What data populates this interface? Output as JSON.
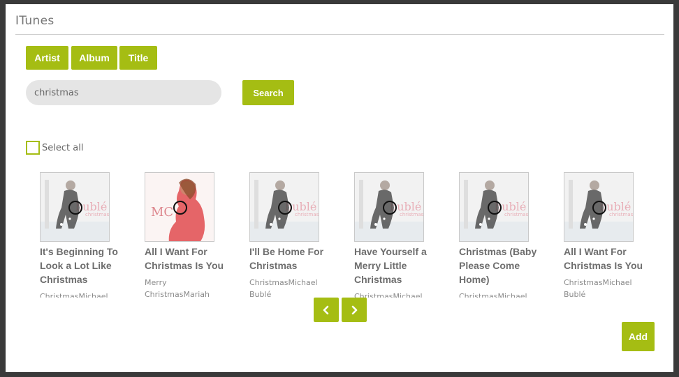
{
  "modal": {
    "title": "ITunes"
  },
  "filters": {
    "artist_label": "Artist",
    "album_label": "Album",
    "title_label": "Title"
  },
  "search": {
    "value": "christmas",
    "button_label": "Search"
  },
  "selection": {
    "select_all_label": "Select all",
    "checked": false
  },
  "tracks": [
    {
      "title": "It's Beginning To Look a Lot Like Christmas",
      "subtitle": "ChristmasMichael Bublé",
      "cover": "michael-buble-christmas-cover"
    },
    {
      "title": "All I Want For Christmas Is You",
      "subtitle": "Merry ChristmasMariah Carey",
      "cover": "mariah-carey-merry-christmas-cover"
    },
    {
      "title": "I'll Be Home For Christmas",
      "subtitle": "ChristmasMichael Bublé",
      "cover": "michael-buble-christmas-cover"
    },
    {
      "title": "Have Yourself a Merry Little Christmas",
      "subtitle": "ChristmasMichael Bublé",
      "cover": "michael-buble-christmas-cover"
    },
    {
      "title": "Christmas (Baby Please Come Home)",
      "subtitle": "ChristmasMichael Bublé",
      "cover": "michael-buble-christmas-cover"
    },
    {
      "title": "All I Want For Christmas Is You",
      "subtitle": "ChristmasMichael Bublé",
      "cover": "michael-buble-christmas-cover"
    }
  ],
  "pagination": {
    "prev_icon": "chevron-left-icon",
    "next_icon": "chevron-right-icon"
  },
  "actions": {
    "add_label": "Add"
  },
  "colors": {
    "accent": "#a5bd13",
    "backdrop": "#3a3a3a"
  }
}
